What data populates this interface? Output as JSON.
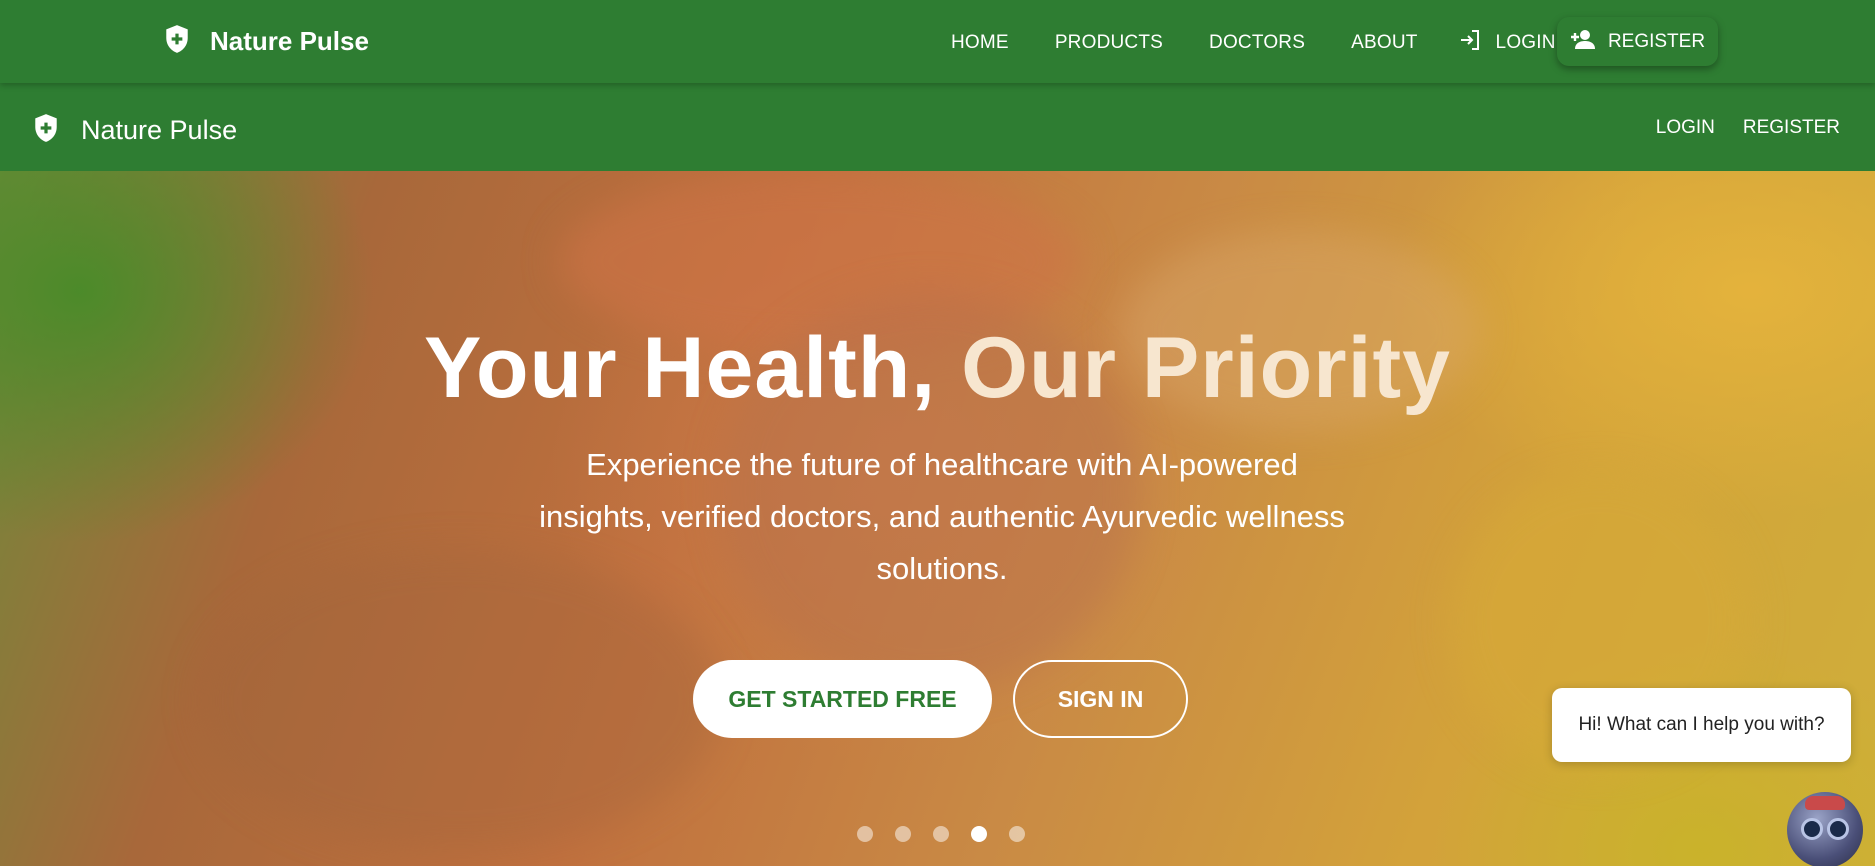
{
  "topnav": {
    "brand": "Nature Pulse",
    "items": [
      "HOME",
      "PRODUCTS",
      "DOCTORS",
      "ABOUT"
    ],
    "login": "LOGIN",
    "register": "REGISTER"
  },
  "appbar": {
    "brand": "Nature Pulse",
    "login": "LOGIN",
    "register": "REGISTER"
  },
  "hero": {
    "headline_part1": "Your Health,",
    "headline_part2": "Our Priority",
    "subtitle": "Experience the future of healthcare with AI-powered insights, verified doctors, and authentic Ayurvedic wellness solutions.",
    "cta": "GET STARTED FREE",
    "signin": "SIGN IN",
    "carousel_count": 5,
    "carousel_active_index": 3
  },
  "chat": {
    "bubble": "Hi! What can I help you with?"
  },
  "colors": {
    "primary": "#2e7d32",
    "white": "#ffffff",
    "headline_accent": "#f7e6cf"
  },
  "icons": [
    "shield-plus-icon",
    "login-icon",
    "person-add-icon",
    "chatbot-avatar-icon"
  ]
}
